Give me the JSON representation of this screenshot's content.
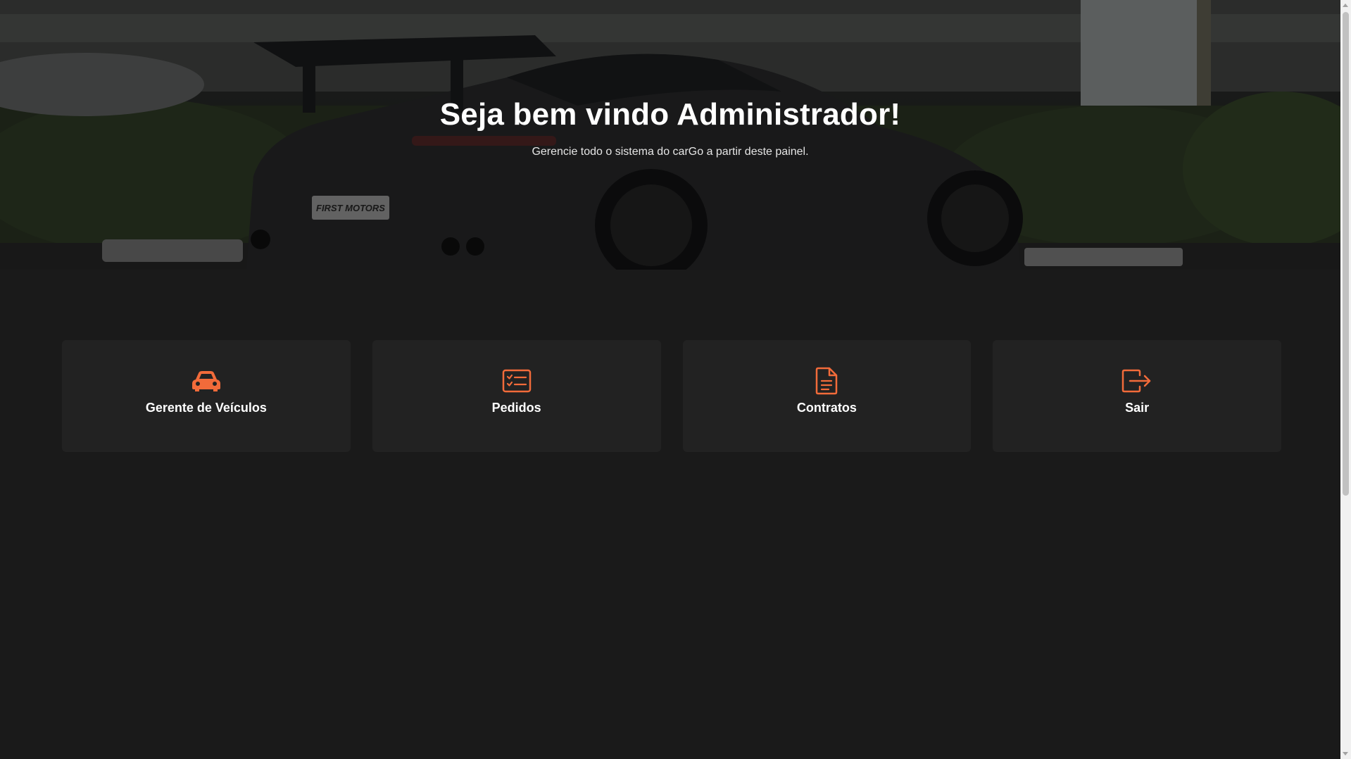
{
  "hero": {
    "title": "Seja bem vindo Administrador!",
    "subtitle": "Gerencie todo o sistema do carGo a partir deste painel.",
    "plate_text": "FIRST MOTORS"
  },
  "cards": [
    {
      "label": "Gerente de Veículos",
      "icon": "car-icon"
    },
    {
      "label": "Pedidos",
      "icon": "checklist-icon"
    },
    {
      "label": "Contratos",
      "icon": "document-icon"
    },
    {
      "label": "Sair",
      "icon": "logout-icon"
    }
  ],
  "colors": {
    "background": "#1a1a1a",
    "card": "#222222",
    "accent": "#f26b3a",
    "text": "#ffffff"
  }
}
